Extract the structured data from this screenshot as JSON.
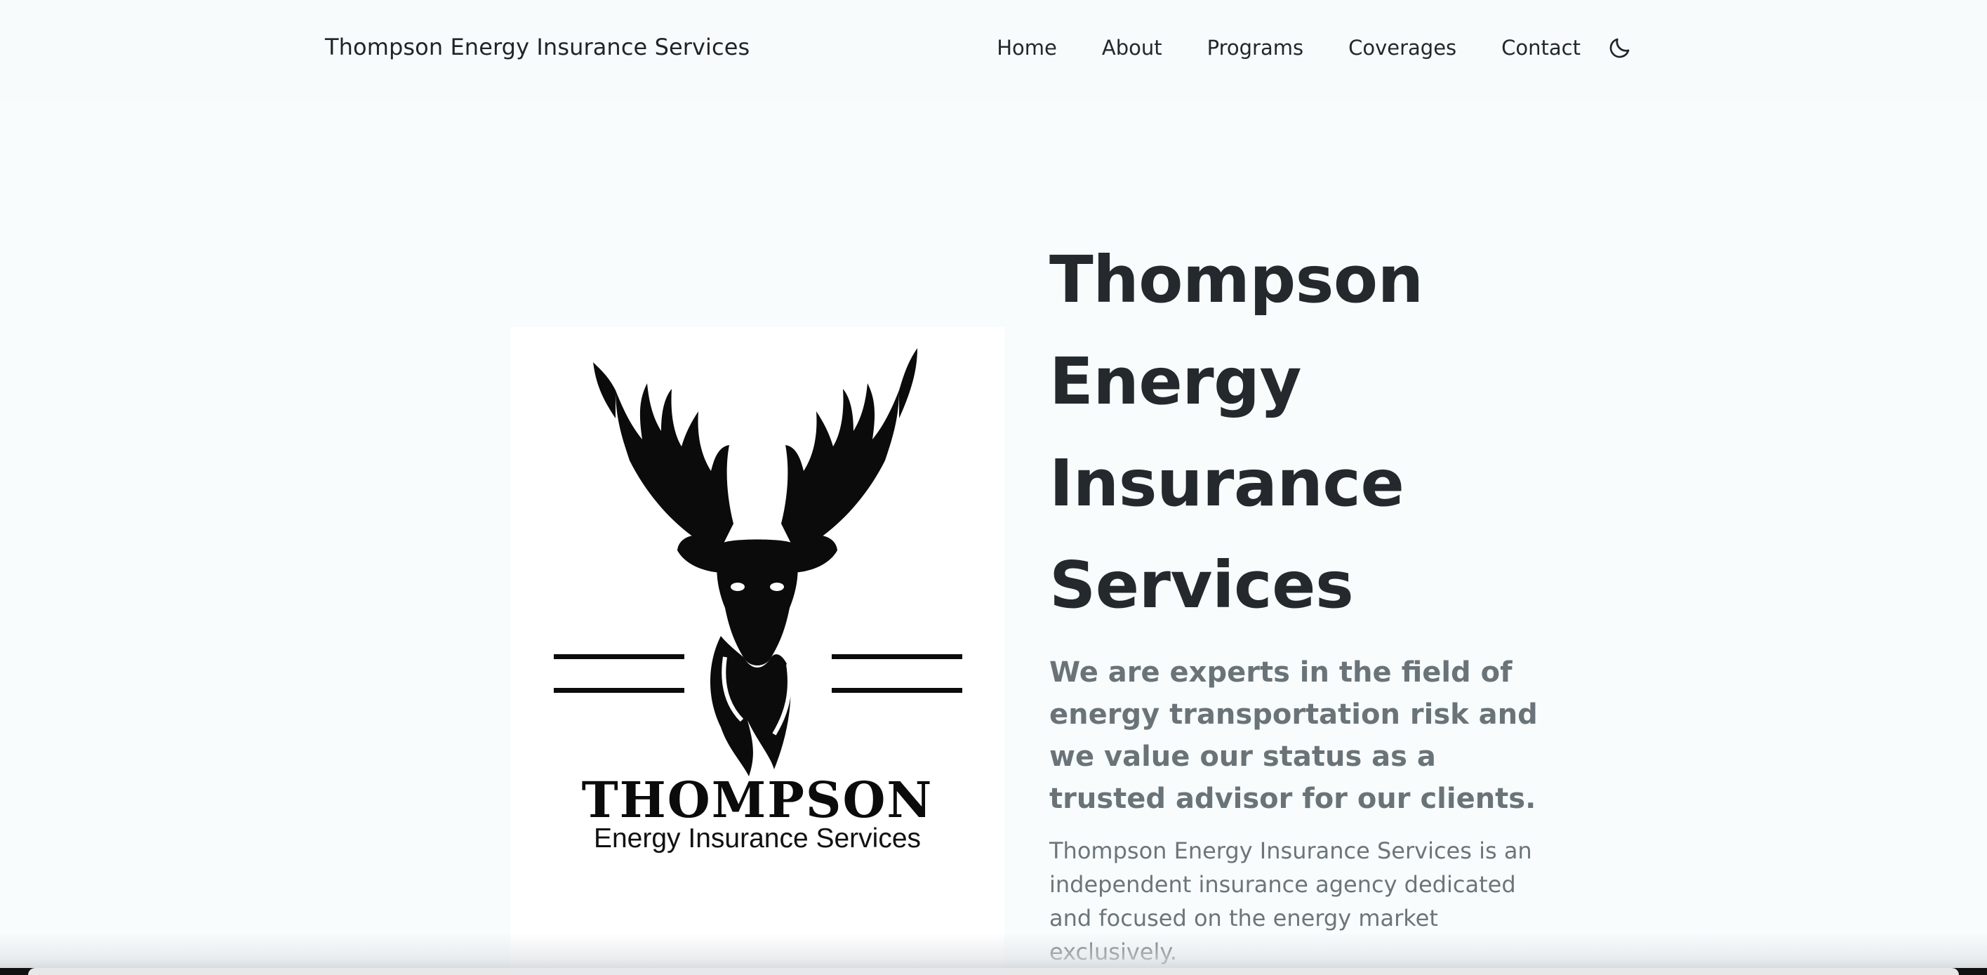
{
  "header": {
    "brand": "Thompson Energy Insurance Services",
    "nav": {
      "home": "Home",
      "about": "About",
      "programs": "Programs",
      "coverages": "Coverages",
      "contact": "Contact"
    },
    "theme_toggle_icon": "moon-icon"
  },
  "hero": {
    "logo": {
      "wordmark": "THOMPSON",
      "subtitle": "Energy Insurance Services",
      "emblem": "stag-head-icon"
    },
    "title": "Thompson Energy Insurance Services",
    "lead": "We are experts in the field of energy transportation risk and we value our status as a trusted advisor for our clients.",
    "description": "Thompson Energy Insurance Services is an independent insurance agency dedicated and focused on the energy market exclusively."
  },
  "colors": {
    "background": "#f8fcfd",
    "heading": "#24292d",
    "muted_text": "#6a7478"
  }
}
